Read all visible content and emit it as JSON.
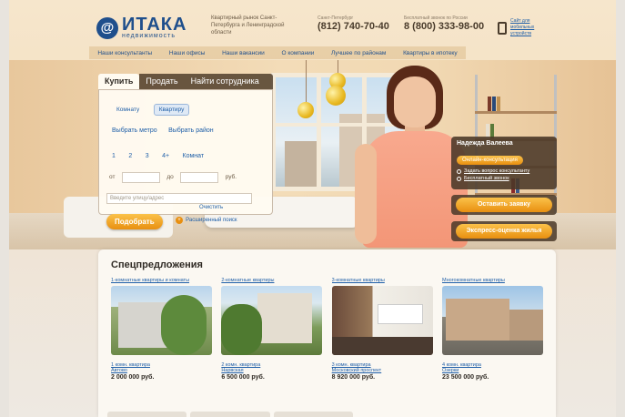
{
  "header": {
    "logo_mark": "@",
    "logo_name": "ИТАКА",
    "logo_sub": "недвижимость",
    "tagline": "Квартирный рынок Санкт-Петербурга и Ленинградской области",
    "phone1_caption": "Санкт-Петербург",
    "phone1": "(812) 740-70-40",
    "phone2_caption": "Бесплатный звонок по России",
    "phone2": "8 (800) 333-98-00",
    "mobile_label": "Сайт для мобильных устройств"
  },
  "nav": [
    "Наши консультанты",
    "Наши офисы",
    "Наши вакансии",
    "О компании",
    "Лучшее по районам",
    "Квартиры в ипотеку"
  ],
  "search": {
    "tabs": [
      "Купить",
      "Продать",
      "Найти сотрудника"
    ],
    "type_options": [
      "Комнату",
      "Квартиру"
    ],
    "metro_link": "Выбрать метро",
    "district_link": "Выбрать район",
    "rooms": [
      "1",
      "2",
      "3",
      "4+",
      "Комнат"
    ],
    "from_label": "от",
    "to_label": "до",
    "currency": "руб.",
    "address_placeholder": "Введите улицу/адрес",
    "submit": "Подобрать",
    "advanced": "Расширенный поиск",
    "clear": "Очистить"
  },
  "consultant": {
    "name": "Надежда Валеева",
    "ask_button": "Онлайн-консультация",
    "link1": "Задать вопрос консультанту",
    "link2": "Бесплатный звонок"
  },
  "actions": [
    "Оставить заявку",
    "Экспресс-оценка жилья"
  ],
  "specials": {
    "title": "Спецпредложения",
    "cards": [
      {
        "head": "1-комнатные квартиры и комнаты",
        "line1": "1 комн. квартира",
        "line2": "Автово",
        "price": "2 000 000 руб."
      },
      {
        "head": "2-комнатные квартиры",
        "line1": "2 комн. квартира",
        "line2": "Нарвская",
        "price": "6 500 000 руб."
      },
      {
        "head": "3-комнатные квартиры",
        "line1": "3 комн. квартира",
        "line2": "Московский проспект",
        "price": "8 920 000 руб."
      },
      {
        "head": "Многокомнатные квартиры",
        "line1": "4 комн. квартира",
        "line2": "Озерки",
        "price": "23 500 000 руб."
      }
    ]
  }
}
